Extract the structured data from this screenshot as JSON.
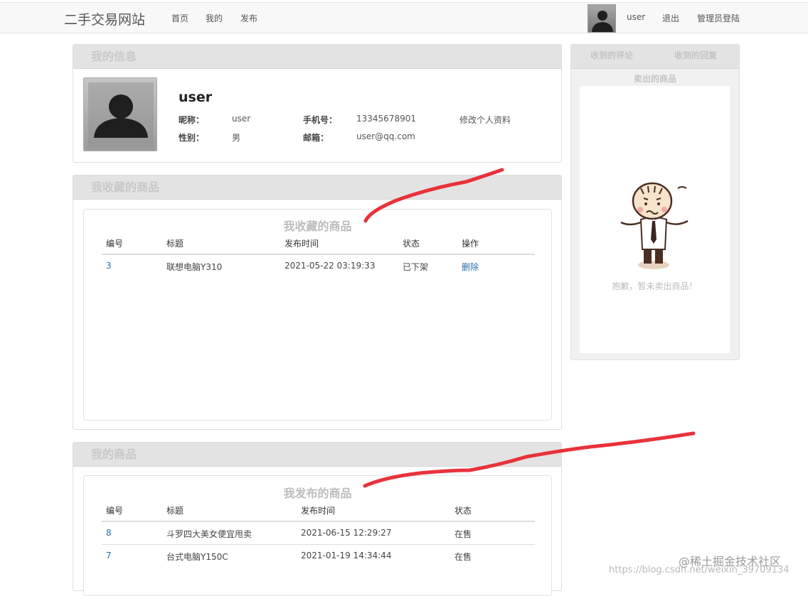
{
  "navbar": {
    "brand": "二手交易网站",
    "links": [
      "首页",
      "我的",
      "发布"
    ],
    "username": "user",
    "logout": "退出",
    "admin_login": "管理员登陆"
  },
  "profile": {
    "header": "我的信息",
    "name": "user",
    "nickname_label": "昵称：",
    "nickname": "user",
    "phone_label": "手机号：",
    "phone": "13345678901",
    "edit_link": "修改个人资料",
    "gender_label": "性别：",
    "gender": "男",
    "email_label": "邮箱：",
    "email": "user@qq.com"
  },
  "favorites": {
    "header": "我收藏的商品",
    "table_title": "我收藏的商品",
    "columns": [
      "编号",
      "标题",
      "发布时间",
      "状态",
      "操作"
    ],
    "rows": [
      {
        "id": "3",
        "title": "联想电脑Y310",
        "time": "2021-05-22 03:19:33",
        "status": "已下架",
        "action": "删除"
      }
    ]
  },
  "my_goods": {
    "header": "我的商品",
    "table_title": "我发布的商品",
    "columns": [
      "编号",
      "标题",
      "发布时间",
      "状态"
    ],
    "rows": [
      {
        "id": "8",
        "title": "斗罗四大美女便宜甩卖",
        "time": "2021-06-15 12:29:27",
        "status": "在售"
      },
      {
        "id": "7",
        "title": "台式电脑Y150C",
        "time": "2021-01-19 14:34:44",
        "status": "在售"
      }
    ]
  },
  "sidebar": {
    "tabs": [
      "收到的评论",
      "收到的回复"
    ],
    "section_title": "卖出的商品",
    "empty_message": "抱歉，暂未卖出商品！"
  },
  "watermark": {
    "brand": "@稀土掘金技术社区",
    "url": "https://blog.csdn.net/weixin_39709134"
  },
  "colors": {
    "annotation": "#e8323a",
    "link": "#2a6fa8",
    "panel_header": "#e3e3e3"
  }
}
